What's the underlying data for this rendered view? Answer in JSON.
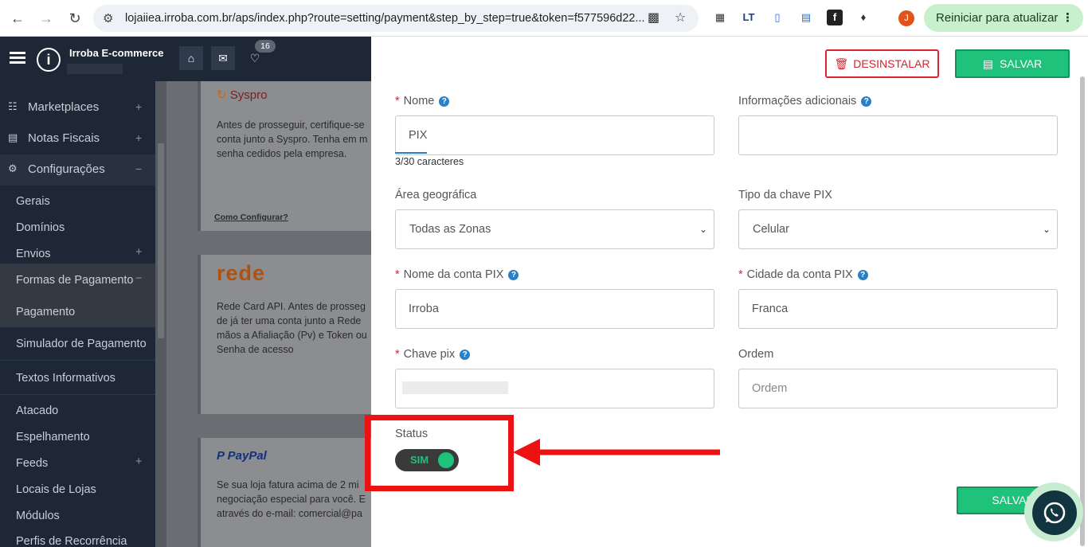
{
  "browser": {
    "url": "lojaiiea.irroba.com.br/aps/index.php?route=setting/payment&step_by_step=true&token=f577596d22...",
    "avatar_letter": "J",
    "restart_label": "Reiniciar para atualizar",
    "extensions": [
      "qr-icon",
      "lt-icon",
      "doc-icon",
      "id-card-icon",
      "fx-icon",
      "puzzle-icon"
    ]
  },
  "app": {
    "brand": "Irroba E-commerce",
    "notification_count": "16"
  },
  "sidebar": {
    "items": [
      {
        "label": "Marketplaces",
        "icon": "sitemap-icon",
        "toggle": "+"
      },
      {
        "label": "Notas Fiscais",
        "icon": "list-icon",
        "toggle": "+"
      },
      {
        "label": "Configurações",
        "icon": "cogs-icon",
        "toggle": "−"
      }
    ],
    "sub_items": [
      {
        "label": "Gerais"
      },
      {
        "label": "Domínios"
      },
      {
        "label": "Envios",
        "toggle": "+"
      },
      {
        "label": "Formas de Pagamento",
        "toggle": "−"
      },
      {
        "label": "Pagamento"
      },
      {
        "label": "Simulador de Pagamento"
      },
      {
        "label": "Textos Informativos"
      },
      {
        "label": "Atacado"
      },
      {
        "label": "Espelhamento"
      },
      {
        "label": "Feeds",
        "toggle": "+"
      },
      {
        "label": "Locais de Lojas"
      },
      {
        "label": "Módulos"
      },
      {
        "label": "Perfis de Recorrência"
      }
    ]
  },
  "cards": [
    {
      "logo": "Syspro",
      "text_lines": [
        "Antes de prosseguir, certifique-se",
        "conta junto a Syspro. Tenha em m",
        "senha cedidos pela empresa."
      ],
      "link": "Como Configurar?"
    },
    {
      "logo": "rede",
      "text_lines": [
        "Rede Card API. Antes de prosseg",
        "de já ter uma conta junto a Rede",
        "mãos a Afialiação (Pv) e Token ou",
        "Senha de acesso"
      ]
    },
    {
      "logo": "PayPal",
      "text_lines": [
        "Se sua loja fatura acima de 2 mi",
        "negociação especial para você. E",
        "através do e-mail: comercial@pa"
      ]
    }
  ],
  "modal": {
    "uninstall_label": "DESINSTALAR",
    "save_label": "SALVAR",
    "save_bottom_label": "SALVAR",
    "fields": {
      "nome": {
        "label": "Nome",
        "value": "PIX",
        "counter": "3/30 caracteres"
      },
      "info": {
        "label": "Informações adicionais",
        "value": ""
      },
      "area": {
        "label": "Área geográfica",
        "value": "Todas as Zonas"
      },
      "tipo_chave": {
        "label": "Tipo da chave PIX",
        "value": "Celular"
      },
      "nome_conta": {
        "label": "Nome da conta PIX",
        "value": "Irroba"
      },
      "cidade_conta": {
        "label": "Cidade da conta PIX",
        "value": "Franca"
      },
      "chave": {
        "label": "Chave pix",
        "value": ""
      },
      "ordem": {
        "label": "Ordem",
        "placeholder": "Ordem"
      },
      "status": {
        "label": "Status",
        "value": "SIM"
      }
    }
  },
  "colors": {
    "accent_green": "#1ec27a",
    "danger_red": "#d9232d",
    "annotation_red": "#ee1111",
    "sidebar_bg": "#1d2735"
  }
}
